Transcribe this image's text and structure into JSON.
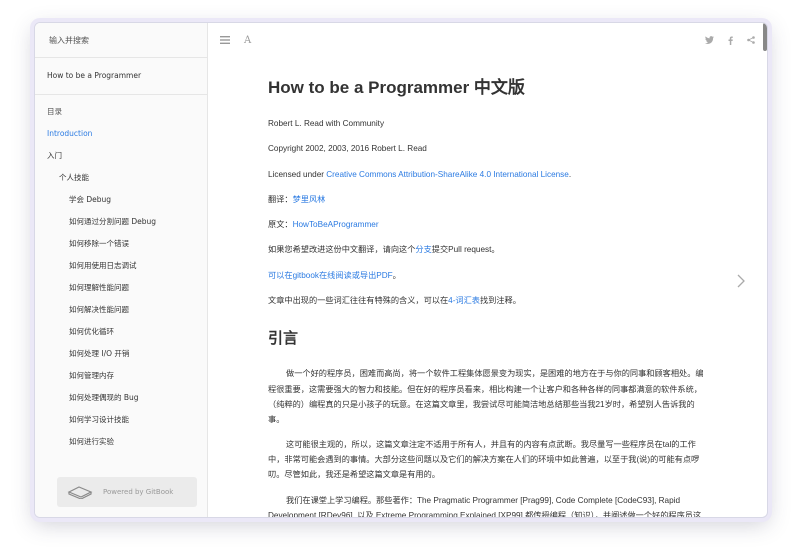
{
  "sidebar": {
    "search_placeholder": "输入并搜索",
    "book_title": "How to be a Programmer",
    "items": [
      {
        "label": "目录",
        "level": 0,
        "active": false
      },
      {
        "label": "Introduction",
        "level": 0,
        "active": true
      },
      {
        "label": "入门",
        "level": 0,
        "active": false
      },
      {
        "label": "个人技能",
        "level": 1,
        "active": false
      },
      {
        "label": "学会 Debug",
        "level": 2,
        "active": false
      },
      {
        "label": "如何通过分割问题 Debug",
        "level": 2,
        "active": false
      },
      {
        "label": "如何移除一个错误",
        "level": 2,
        "active": false
      },
      {
        "label": "如何用使用日志调试",
        "level": 2,
        "active": false
      },
      {
        "label": "如何理解性能问题",
        "level": 2,
        "active": false
      },
      {
        "label": "如何解决性能问题",
        "level": 2,
        "active": false
      },
      {
        "label": "如何优化循环",
        "level": 2,
        "active": false
      },
      {
        "label": "如何处理 I/O 开销",
        "level": 2,
        "active": false
      },
      {
        "label": "如何管理内存",
        "level": 2,
        "active": false
      },
      {
        "label": "如何处理偶现的 Bug",
        "level": 2,
        "active": false
      },
      {
        "label": "如何学习设计技能",
        "level": 2,
        "active": false
      },
      {
        "label": "如何进行实验",
        "level": 2,
        "active": false
      }
    ],
    "gitbook_label": "Powered by GitBook"
  },
  "toolbar": {
    "font_label": "A"
  },
  "content": {
    "title": "How to be a Programmer 中文版",
    "author": "Robert L. Read with Community",
    "copyright": "Copyright 2002, 2003, 2016 Robert L. Read",
    "license_prefix": "Licensed under ",
    "license_link": "Creative Commons Attribution-ShareAlike 4.0 International License",
    "license_suffix": ".",
    "translator_prefix": "翻译：",
    "translator_link": "梦里风林",
    "original_prefix": "原文：",
    "original_link": "HowToBeAProgrammer",
    "improve_prefix": "如果您希望改进这份中文翻译，请向这个",
    "improve_link": "分支",
    "improve_suffix": "提交Pull request。",
    "gitbook_read_link": "可以在gitbook在线阅读或导出PDF",
    "gitbook_read_suffix": "。",
    "glossary_prefix": "文章中出现的一些词汇往往有特殊的含义，可以在",
    "glossary_link": "4-词汇表",
    "glossary_suffix": "找到注释。",
    "section_title": "引言",
    "para1": "做一个好的程序员，困难而高尚，将一个软件工程集体愿景变为现实，是困难的地方在于与你的同事和顾客相处。编程很重要，这需要强大的智力和技能。但在好的程序员看来，相比构建一个让客户和各种各样的同事都满意的软件系统，（纯粹的）编程真的只是小孩子的玩意。在这篇文章里，我尝试尽可能简洁地总结那些当我21岁时，希望别人告诉我的事。",
    "para2": "这可能很主观的，所以，这篇文章注定不适用于所有人，并且有的内容有点武断。我尽量写一些程序员在tal的工作中，非常可能会遇到的事情。大部分这些问题以及它们的解决方案在人们的环境中如此普遍，以至于我(说)的可能有点啰叨。尽管如此，我还是希望这篇文章是有用的。",
    "para3": "我们在课堂上学习编程。那些著作：The Pragmatic Programmer [Prag99], Code Complete [CodeC93], Rapid Development [RDev96], 以及 Extreme Programming Explained [XP99] 都传授编程（知识），并阐述做一个好的程序员这个大话题。在读这篇文章之前，或者就是现在，你当然也应该读一读Paul Graham"
  }
}
